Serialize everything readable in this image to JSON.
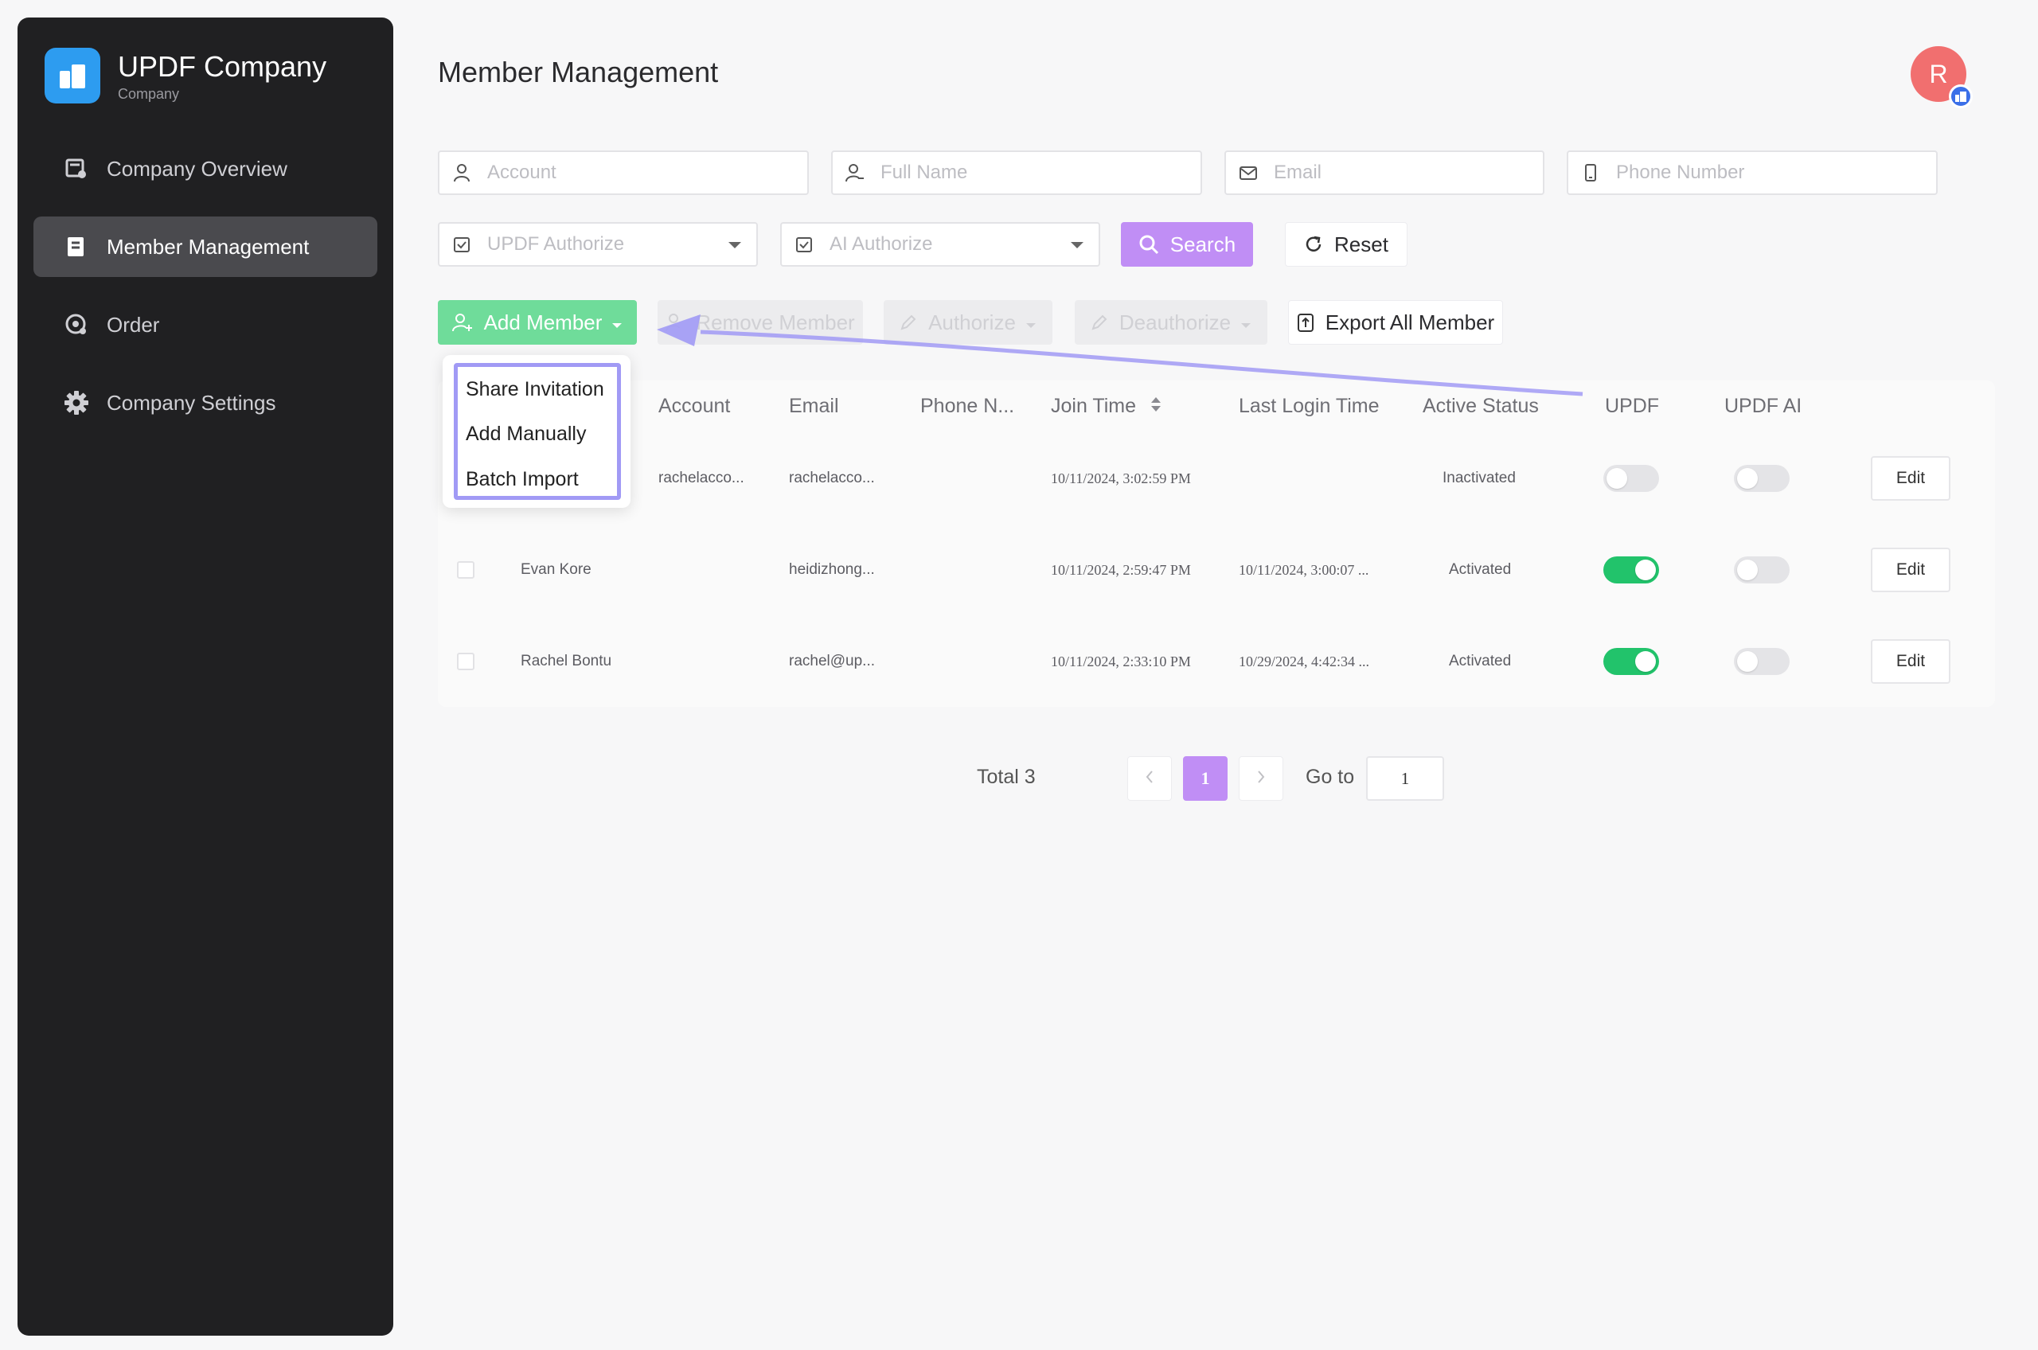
{
  "sidebar": {
    "brand_name": "UPDF Company",
    "brand_sub": "Company",
    "items": [
      {
        "label": "Company Overview",
        "icon": "overview-icon"
      },
      {
        "label": "Member Management",
        "icon": "member-icon"
      },
      {
        "label": "Order",
        "icon": "order-icon"
      },
      {
        "label": "Company Settings",
        "icon": "gear-icon"
      }
    ]
  },
  "header": {
    "title": "Member Management",
    "avatar_letter": "R"
  },
  "filters": {
    "account_placeholder": "Account",
    "fullname_placeholder": "Full Name",
    "email_placeholder": "Email",
    "phone_placeholder": "Phone Number",
    "updf_authorize_placeholder": "UPDF Authorize",
    "ai_authorize_placeholder": "AI Authorize",
    "search_label": "Search",
    "reset_label": "Reset"
  },
  "toolbar": {
    "add_member_label": "Add Member",
    "remove_member_label": "Remove Member",
    "authorize_label": "Authorize",
    "deauthorize_label": "Deauthorize",
    "export_label": "Export All Member"
  },
  "add_menu": {
    "items": [
      "Share Invitation",
      "Add Manually",
      "Batch Import"
    ]
  },
  "table": {
    "headers": {
      "account": "Account",
      "email": "Email",
      "phone": "Phone N...",
      "join_time": "Join Time",
      "last_login": "Last Login Time",
      "active_status": "Active Status",
      "updf": "UPDF",
      "updf_ai": "UPDF AI"
    },
    "rows": [
      {
        "name": "",
        "account": "rachelacco...",
        "email": "rachelacco...",
        "phone": "",
        "join_time": "10/11/2024, 3:02:59 PM",
        "last_login": "",
        "status": "Inactivated",
        "updf_on": false,
        "ai_on": false,
        "edit_label": "Edit"
      },
      {
        "name": "Evan Kore",
        "account": "",
        "email": "heidizhong...",
        "phone": "",
        "join_time": "10/11/2024, 2:59:47 PM",
        "last_login": "10/11/2024, 3:00:07 ...",
        "status": "Activated",
        "updf_on": true,
        "ai_on": false,
        "edit_label": "Edit"
      },
      {
        "name": "Rachel Bontu",
        "account": "",
        "email": "rachel@up...",
        "phone": "",
        "join_time": "10/11/2024, 2:33:10 PM",
        "last_login": "10/29/2024, 4:42:34 ...",
        "status": "Activated",
        "updf_on": true,
        "ai_on": false,
        "edit_label": "Edit"
      }
    ]
  },
  "pagination": {
    "total_label": "Total 3",
    "current_page": "1",
    "goto_label": "Go to",
    "goto_value": "1"
  },
  "colors": {
    "accent_purple": "#c08ef5",
    "add_green": "#6fdc9a",
    "toggle_on": "#22c36b",
    "annotation": "#a19af5"
  }
}
